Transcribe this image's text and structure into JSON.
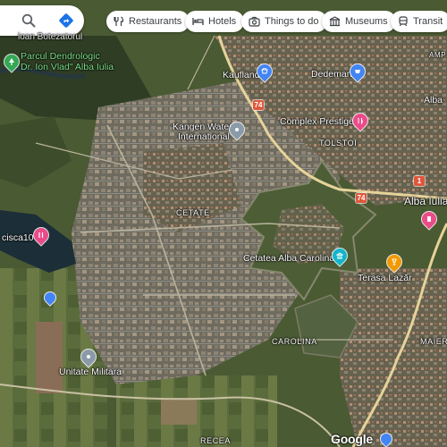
{
  "search": {
    "search_icon": "search-icon",
    "directions_icon": "directions-icon",
    "partial_result_text": "ioan Botezatorul"
  },
  "chips": [
    {
      "label": "Restaurants",
      "icon": "fork-knife-icon"
    },
    {
      "label": "Hotels",
      "icon": "bed-icon"
    },
    {
      "label": "Things to do",
      "icon": "camera-icon"
    },
    {
      "label": "Museums",
      "icon": "museum-icon"
    },
    {
      "label": "Transit",
      "icon": "train-icon"
    }
  ],
  "places": {
    "parcul_line1": "Parcul Dendrologic",
    "parcul_line2": "Dr. Ion Vlad\" Alba Iulia",
    "kaufland": "Kaufland",
    "dedeman": "Dedeman",
    "kangen_line1": "Kangen Water",
    "kangen_line2": "International",
    "complex": "Complex Prestige",
    "tolstoi": "TOLSTOI",
    "alba_iulia": "Alba Iulia",
    "cetate": "CETATE",
    "cisca": "cisca10",
    "cetatea": "Cetatea Alba Carolina",
    "terasa": "Terasa Lazăr",
    "carolina": "CAROLINA",
    "maier": "MAIER",
    "unitate": "Unitate Militara",
    "recea": "RECEA",
    "alba_top_right": "Alba",
    "amp": "AMP"
  },
  "roads": [
    "74",
    "74",
    "1"
  ],
  "attribution": "Google",
  "colors": {
    "hotel_pin": "#4285f4",
    "shop_pin": "#4285f4",
    "food_pin": "#ea4c89",
    "attraction_pin": "#12b5cb",
    "bar_pin": "#f29900",
    "park_pin": "#34a853",
    "road_shield": "#e0573b"
  }
}
